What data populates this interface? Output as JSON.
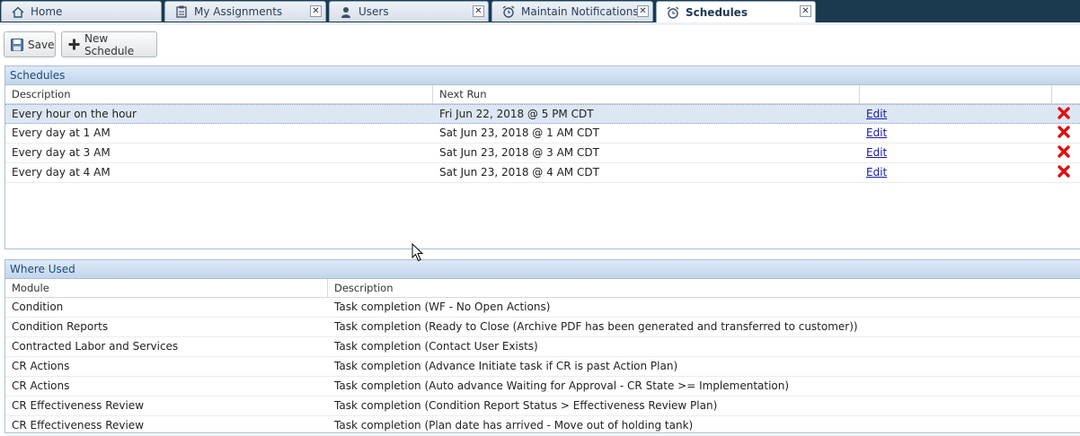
{
  "tabs": [
    {
      "label": "Home",
      "icon": "home-icon",
      "closable": false
    },
    {
      "label": "My Assignments",
      "icon": "clipboard-icon",
      "closable": true
    },
    {
      "label": "Users",
      "icon": "user-icon",
      "closable": true
    },
    {
      "label": "Maintain Notifications",
      "icon": "alarm-clock-icon",
      "closable": true
    },
    {
      "label": "Schedules",
      "icon": "alarm-clock-icon",
      "closable": true,
      "active": true
    }
  ],
  "toolbar": {
    "save_label": "Save",
    "new_schedule_label": "New Schedule"
  },
  "schedules": {
    "title": "Schedules",
    "columns": {
      "description": "Description",
      "next_run": "Next Run"
    },
    "rows": [
      {
        "description": "Every hour on the hour",
        "next_run": "Fri Jun 22, 2018 @ 5 PM CDT",
        "edit": "Edit",
        "selected": true
      },
      {
        "description": "Every day at 1 AM",
        "next_run": "Sat Jun 23, 2018 @ 1 AM CDT",
        "edit": "Edit"
      },
      {
        "description": "Every day at 3 AM",
        "next_run": "Sat Jun 23, 2018 @ 3 AM CDT",
        "edit": "Edit"
      },
      {
        "description": "Every day at 4 AM",
        "next_run": "Sat Jun 23, 2018 @ 4 AM CDT",
        "edit": "Edit"
      }
    ]
  },
  "where_used": {
    "title": "Where Used",
    "columns": {
      "module": "Module",
      "description": "Description"
    },
    "rows": [
      {
        "module": "Condition",
        "description": "Task completion (WF - No Open Actions)"
      },
      {
        "module": "Condition Reports",
        "description": "Task completion (Ready to Close (Archive PDF has been generated and transferred to customer))"
      },
      {
        "module": "Contracted Labor and Services",
        "description": "Task completion (Contact User Exists)"
      },
      {
        "module": "CR Actions",
        "description": "Task completion (Advance Initiate task if CR is past Action Plan)"
      },
      {
        "module": "CR Actions",
        "description": "Task completion (Auto advance Waiting for Approval - CR State >= Implementation)"
      },
      {
        "module": "CR Effectiveness Review",
        "description": "Task completion (Condition Report Status > Effectiveness Review Plan)"
      },
      {
        "module": "CR Effectiveness Review",
        "description": "Task completion (Plan date has arrived - Move out of holding tank)"
      }
    ]
  },
  "colors": {
    "tabbar_bg": "#1b3a4f",
    "panel_header_text": "#1d4a7a",
    "delete_red": "#dd1111",
    "link_blue": "#1a1aa8"
  }
}
